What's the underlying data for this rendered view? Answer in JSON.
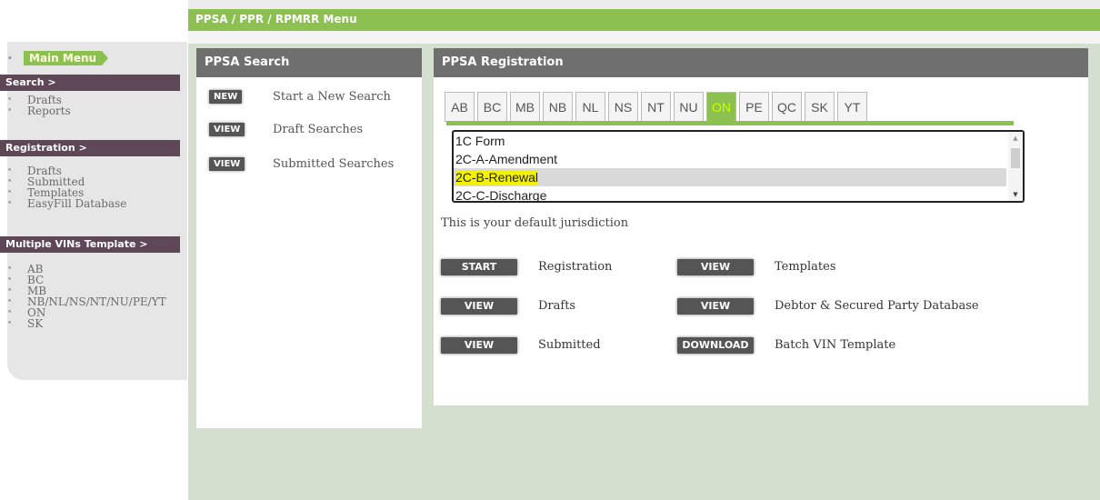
{
  "topbar": {
    "title": "PPSA / PPR / RPMRR Menu"
  },
  "sidebar": {
    "main_menu": "Main Menu",
    "sections": [
      {
        "header": "Search >",
        "items": [
          "Drafts",
          "Reports"
        ]
      },
      {
        "header": "Registration >",
        "items": [
          "Drafts",
          "Submitted",
          "Templates",
          "EasyFill Database"
        ]
      },
      {
        "header": "Multiple VINs Template >",
        "items": [
          "AB",
          "BC",
          "MB",
          "NB/NL/NS/NT/NU/PE/YT",
          "ON",
          "SK"
        ]
      }
    ]
  },
  "search_panel": {
    "title": "PPSA Search",
    "rows": [
      {
        "button": "NEW",
        "label": "Start a New Search"
      },
      {
        "button": "VIEW",
        "label": "Draft Searches"
      },
      {
        "button": "VIEW",
        "label": "Submitted Searches"
      }
    ]
  },
  "registration_panel": {
    "title": "PPSA Registration",
    "jurisdictions": [
      "AB",
      "BC",
      "MB",
      "NB",
      "NL",
      "NS",
      "NT",
      "NU",
      "ON",
      "PE",
      "QC",
      "SK",
      "YT"
    ],
    "active_jurisdiction": "ON",
    "forms": [
      "1C Form",
      "2C-A-Amendment",
      "2C-B-Renewal",
      "2C-C-Discharge"
    ],
    "selected_form": "2C-B-Renewal",
    "default_note": "This is your default jurisdiction",
    "actions": [
      {
        "button": "START",
        "label": "Registration"
      },
      {
        "button": "VIEW",
        "label": "Templates"
      },
      {
        "button": "VIEW",
        "label": "Drafts"
      },
      {
        "button": "VIEW",
        "label": "Debtor & Secured Party Database"
      },
      {
        "button": "VIEW",
        "label": "Submitted"
      },
      {
        "button": "DOWNLOAD",
        "label": "Batch VIN Template"
      }
    ]
  },
  "colors": {
    "accent_green": "#8cc152",
    "header_purple": "#5e4756",
    "panel_header_gray": "#6f6f6f"
  }
}
